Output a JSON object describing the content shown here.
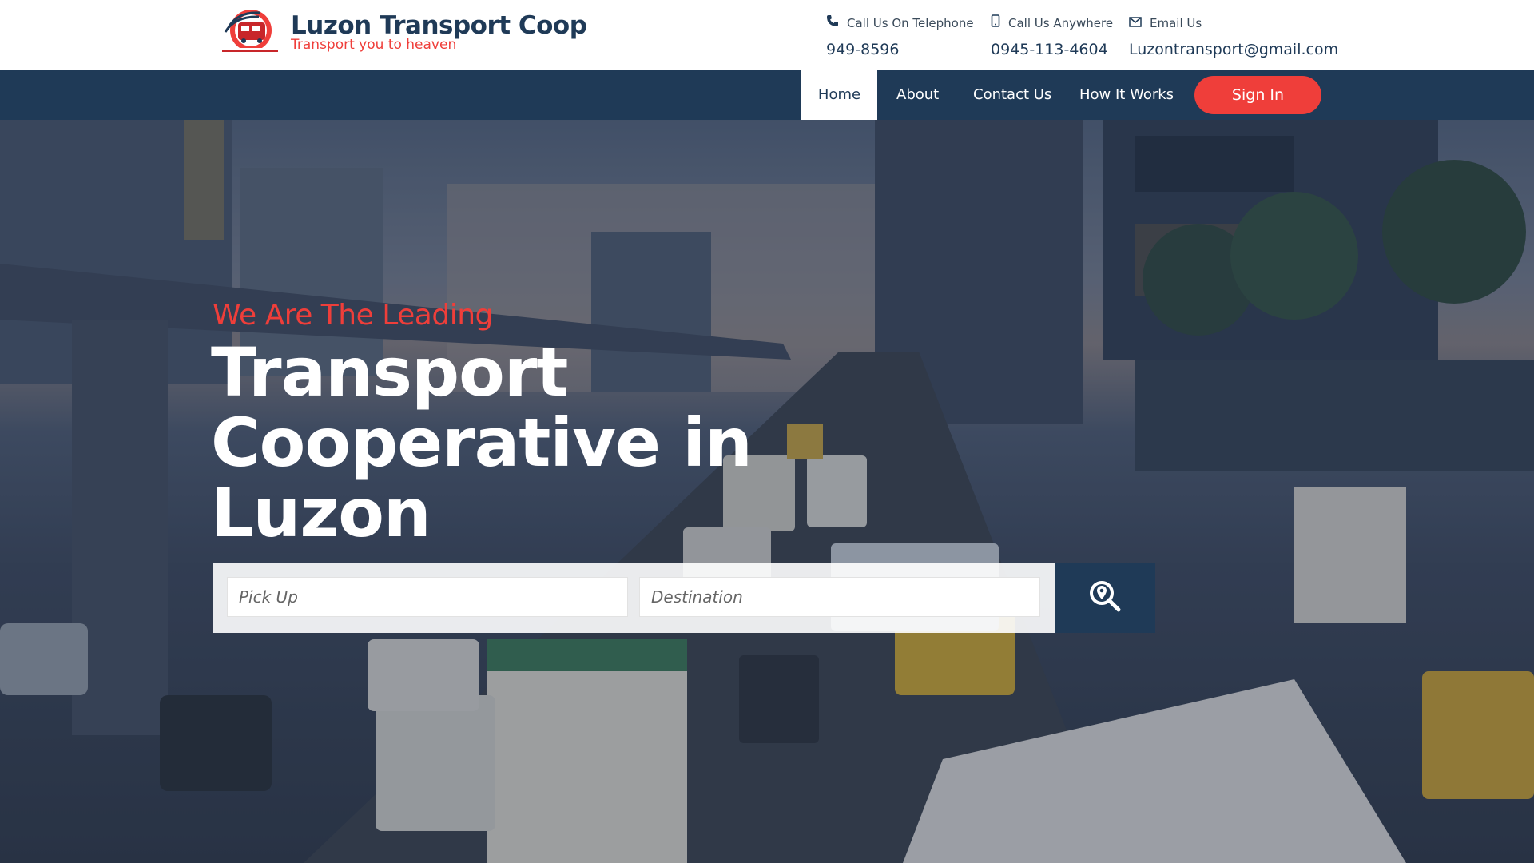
{
  "brand": {
    "title": "Luzon Transport Coop",
    "tagline": "Transport you to heaven",
    "logo_icon": "bus-logo-icon",
    "colors": {
      "primary": "#1f3a57",
      "accent": "#ef3e3a"
    }
  },
  "contacts": [
    {
      "icon": "phone-icon",
      "label": "Call Us On Telephone",
      "value": "949-8596"
    },
    {
      "icon": "mobile-icon",
      "label": "Call Us Anywhere",
      "value": "0945-113-4604"
    },
    {
      "icon": "envelope-icon",
      "label": "Email Us",
      "value": "Luzontransport@gmail.com"
    }
  ],
  "nav": {
    "items": [
      {
        "label": "Home",
        "active": true
      },
      {
        "label": "About",
        "active": false
      },
      {
        "label": "Contact Us",
        "active": false
      },
      {
        "label": "How It Works",
        "active": false
      }
    ],
    "signin_label": "Sign In"
  },
  "hero": {
    "kicker": "We Are The Leading",
    "headline": "Transport Cooperative in Luzon"
  },
  "search": {
    "pickup_placeholder": "Pick Up",
    "destination_placeholder": "Destination",
    "button_icon": "location-search-icon"
  }
}
